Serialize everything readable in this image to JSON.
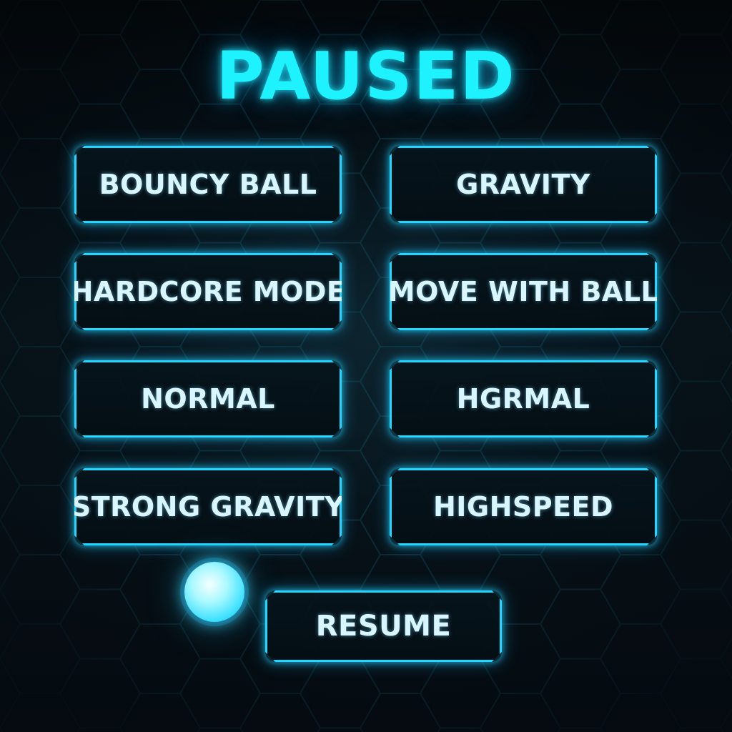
{
  "title": "PAUSED",
  "menu": {
    "buttons": [
      {
        "label": "BOUNCY BALL"
      },
      {
        "label": "GRAVITY"
      },
      {
        "label": "HARDCORE MODE"
      },
      {
        "label": "MOVE WITH BALL"
      },
      {
        "label": "NORMAL"
      },
      {
        "label": "HGRMAL"
      },
      {
        "label": "STRONG GRAVITY"
      },
      {
        "label": "HIGHSPEED"
      }
    ],
    "resume_label": "RESUME"
  },
  "colors": {
    "accent": "#1ef2ff",
    "button_border": "#22d6ff",
    "button_text": "#d9f6ff",
    "background": "#05090d"
  }
}
